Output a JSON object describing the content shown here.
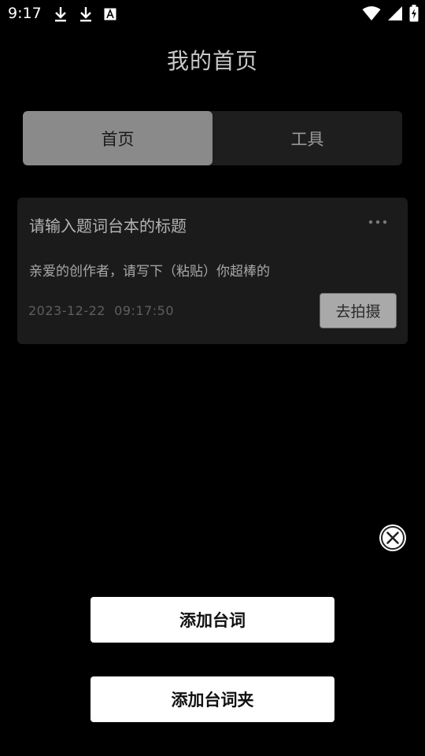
{
  "status_bar": {
    "time": "9:17",
    "left_icons": [
      "download-icon",
      "download-icon",
      "font-icon"
    ],
    "right_icons": [
      "wifi-icon",
      "signal-icon",
      "battery-charging-icon"
    ]
  },
  "header": {
    "title": "我的首页"
  },
  "tabs": [
    {
      "label": "首页",
      "active": true
    },
    {
      "label": "工具",
      "active": false
    }
  ],
  "card": {
    "title": "请输入题词台本的标题",
    "body": "亲爱的创作者，请写下（粘贴）你超棒的",
    "date": "2023-12-22  09:17:50",
    "action_label": "去拍摄",
    "menu_icon": "more-horizontal-icon"
  },
  "fab": {
    "icon": "close-circle-icon"
  },
  "actions": {
    "add_line_label": "添加台词",
    "add_folder_label": "添加台词夹"
  },
  "colors": {
    "background": "#000000",
    "tab_active": "#8a8a8a",
    "card_bg": "#1b1b1b",
    "button_bg": "#ffffff"
  }
}
